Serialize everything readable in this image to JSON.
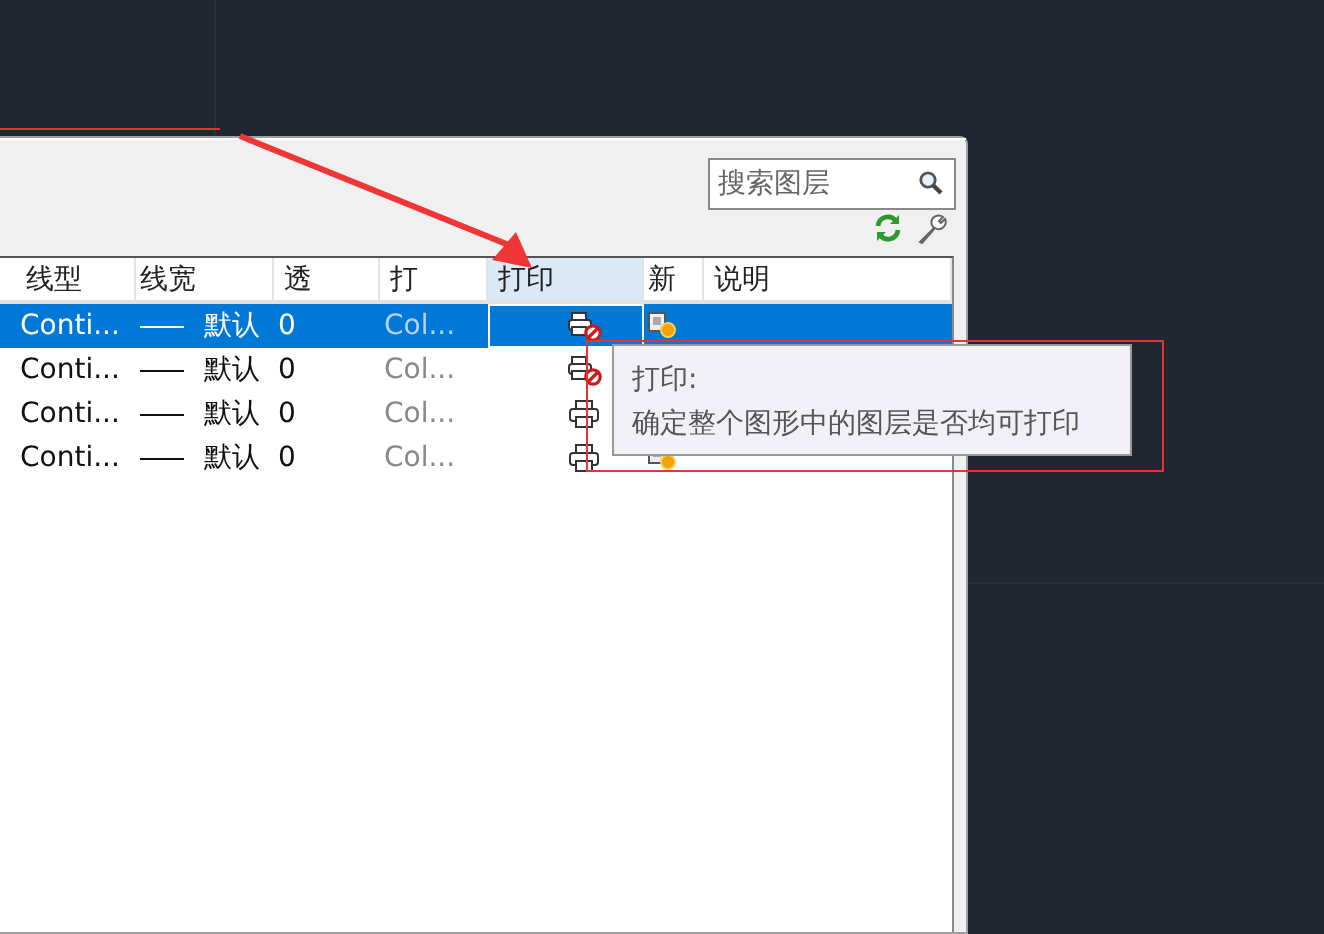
{
  "search": {
    "placeholder": "搜索图层"
  },
  "columns": [
    {
      "label": "线型",
      "selected": false
    },
    {
      "label": "线宽",
      "selected": false
    },
    {
      "label": "透",
      "selected": false
    },
    {
      "label": "打",
      "selected": false
    },
    {
      "label": "打印",
      "selected": true
    },
    {
      "label": "新",
      "selected": false
    },
    {
      "label": "说明",
      "selected": false
    }
  ],
  "rows": [
    {
      "selected": true,
      "linetype": "Conti...",
      "lineweight": "默认",
      "transparency": "0",
      "plot_style": "Col...",
      "plot": false
    },
    {
      "selected": false,
      "linetype": "Conti...",
      "lineweight": "默认",
      "transparency": "0",
      "plot_style": "Col...",
      "plot": false
    },
    {
      "selected": false,
      "linetype": "Conti...",
      "lineweight": "默认",
      "transparency": "0",
      "plot_style": "Col...",
      "plot": true
    },
    {
      "selected": false,
      "linetype": "Conti...",
      "lineweight": "默认",
      "transparency": "0",
      "plot_style": "Col...",
      "plot": true
    }
  ],
  "tooltip": {
    "title": "打印:",
    "text": "确定整个图形中的图层是否均可打印"
  }
}
